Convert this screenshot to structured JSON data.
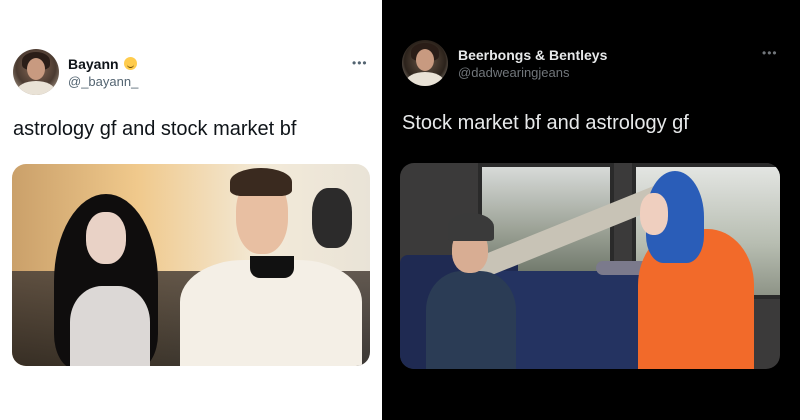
{
  "left_tweet": {
    "display_name": "Bayann",
    "handle": "@_bayann_",
    "more_label": "•••",
    "text": "astrology gf and stock market bf",
    "media_description": "photo"
  },
  "right_tweet": {
    "display_name": "Beerbongs & Bentleys",
    "handle": "@dadwearingjeans",
    "more_label": "•••",
    "text": "Stock market bf and astrology gf",
    "media_description": "photo"
  },
  "colors": {
    "light_bg": "#ffffff",
    "dark_bg": "#000000",
    "light_text": "#0f1419",
    "dark_text": "#e7e9ea",
    "light_secondary": "#536471",
    "dark_secondary": "#71767b"
  },
  "icons": {
    "left_name_badge": "smiling-face-emoji-icon",
    "more": "more-dots-icon"
  }
}
